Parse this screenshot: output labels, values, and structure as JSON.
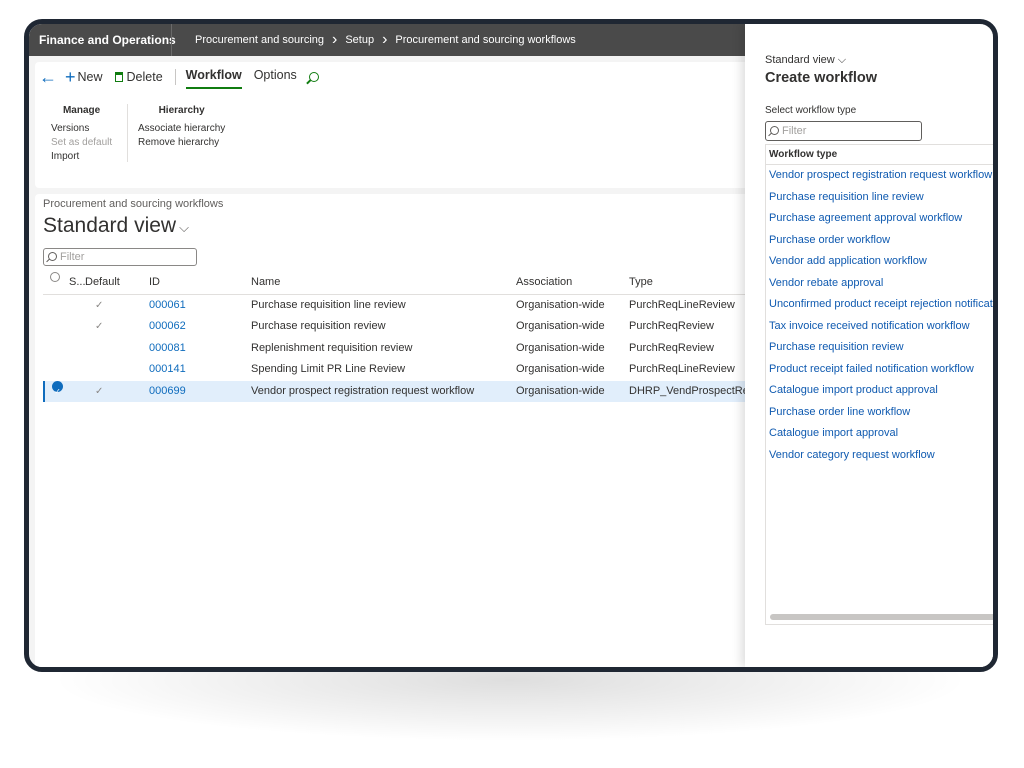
{
  "app": {
    "title": "Finance and Operations",
    "breadcrumb": [
      "Procurement and sourcing",
      "Setup",
      "Procurement and sourcing workflows"
    ]
  },
  "toolbar": {
    "new_label": "New",
    "delete_label": "Delete",
    "tabs": [
      "Workflow",
      "Options"
    ],
    "active_tab": "Workflow"
  },
  "ribbon": {
    "manage": {
      "title": "Manage",
      "items": [
        {
          "label": "Versions",
          "enabled": true
        },
        {
          "label": "Set as default",
          "enabled": false
        },
        {
          "label": "Import",
          "enabled": true
        }
      ]
    },
    "hierarchy": {
      "title": "Hierarchy",
      "items": [
        {
          "label": "Associate hierarchy"
        },
        {
          "label": "Remove hierarchy"
        }
      ]
    }
  },
  "page": {
    "subtitle": "Procurement and sourcing workflows",
    "view_title": "Standard view",
    "filter_placeholder": "Filter"
  },
  "grid": {
    "columns": [
      "S...",
      "Default",
      "ID",
      "Name",
      "Association",
      "Type"
    ],
    "rows": [
      {
        "default": "✓",
        "id": "000061",
        "name": "Purchase requisition line review",
        "association": "Organisation-wide",
        "type": "PurchReqLineReview",
        "selected": false
      },
      {
        "default": "✓",
        "id": "000062",
        "name": "Purchase requisition review",
        "association": "Organisation-wide",
        "type": "PurchReqReview",
        "selected": false
      },
      {
        "default": "",
        "id": "000081",
        "name": "Replenishment requisition review",
        "association": "Organisation-wide",
        "type": "PurchReqReview",
        "selected": false
      },
      {
        "default": "",
        "id": "000141",
        "name": "Spending Limit PR Line Review",
        "association": "Organisation-wide",
        "type": "PurchReqLineReview",
        "selected": false
      },
      {
        "default": "✓",
        "id": "000699",
        "name": "Vendor prospect registration request workflow",
        "association": "Organisation-wide",
        "type": "DHRP_VendProspectRe",
        "selected": true
      }
    ]
  },
  "panel": {
    "view": "Standard view",
    "title": "Create workflow",
    "select_label": "Select workflow type",
    "filter_placeholder": "Filter",
    "column": "Workflow type",
    "items": [
      "Vendor prospect registration request workflow",
      "Purchase requisition line review",
      "Purchase agreement approval workflow",
      "Purchase order workflow",
      "Vendor add application workflow",
      "Vendor rebate approval",
      "Unconfirmed product receipt rejection notificat",
      "Tax invoice received notification workflow",
      "Purchase requisition review",
      "Product receipt failed notification workflow",
      "Catalogue import product approval",
      "Purchase order line workflow",
      "Catalogue import approval",
      "Vendor category request workflow"
    ]
  },
  "icons": {
    "back": "back-arrow-icon",
    "new": "plus-icon",
    "delete": "trash-icon",
    "search": "search-icon",
    "selected": "check-circle-icon"
  },
  "colors": {
    "topbar": "#4a4a4a",
    "accent_green": "#107c10",
    "link_blue": "#0f6cbd",
    "selected_row": "#e1eefb"
  }
}
